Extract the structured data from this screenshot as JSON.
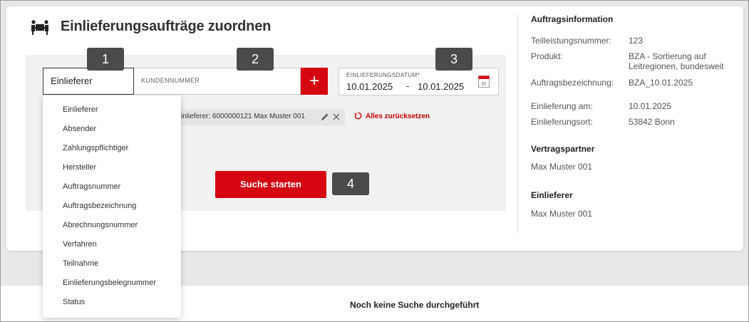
{
  "page": {
    "title": "Einlieferungsaufträge zuordnen",
    "title_icon": "people-carrying-box-icon"
  },
  "search": {
    "select_value": "Einlieferer",
    "kunden_placeholder": "KUNDENNUMMER",
    "add_label": "+",
    "date_label": "EINLIEFERUNGSDATUM*",
    "date_from": "10.01.2025",
    "date_sep": "-",
    "date_to": "10.01.2025",
    "submit_label": "Suche starten"
  },
  "badges": [
    "1",
    "2",
    "3",
    "4"
  ],
  "filter_chip": {
    "text": "inlieferer: 6000000121 Max Muster 001"
  },
  "reset_label": "Alles zurücksetzen",
  "dropdown_options": [
    "Einlieferer",
    "Absender",
    "Zahlungspflichtiger",
    "Hersteller",
    "Auftragsnummer",
    "Auftragsbezeichnung",
    "Abrechnungsnummer",
    "Verfahren",
    "Teilnahme",
    "Einlieferungsbelegnummer",
    "Status"
  ],
  "info": {
    "heading": "Auftragsinformation",
    "rows": [
      {
        "label": "Teilleistungsnummer:",
        "value": "123"
      },
      {
        "label": "Produkt:",
        "value": "BZA - Sortierung auf",
        "value2": "Leitregionen, bundesweit"
      },
      {
        "label": "Auftragsbezeichnung:",
        "value": "BZA_10.01.2025"
      },
      {
        "label": "Einlieferung am:",
        "value": "10.01.2025"
      },
      {
        "label": "Einlieferungsort:",
        "value": "53842 Bonn"
      }
    ],
    "partner_heading": "Vertragspartner",
    "partner_name": "Max Muster 001",
    "einlieferer_heading": "Einlieferer",
    "einlieferer_name": "Max Muster 001"
  },
  "results": {
    "empty_text": "Noch keine Suche durchgeführt"
  },
  "colors": {
    "accent": "#d40511",
    "badge": "#4a4a4a",
    "background": "#e8e8e8"
  }
}
